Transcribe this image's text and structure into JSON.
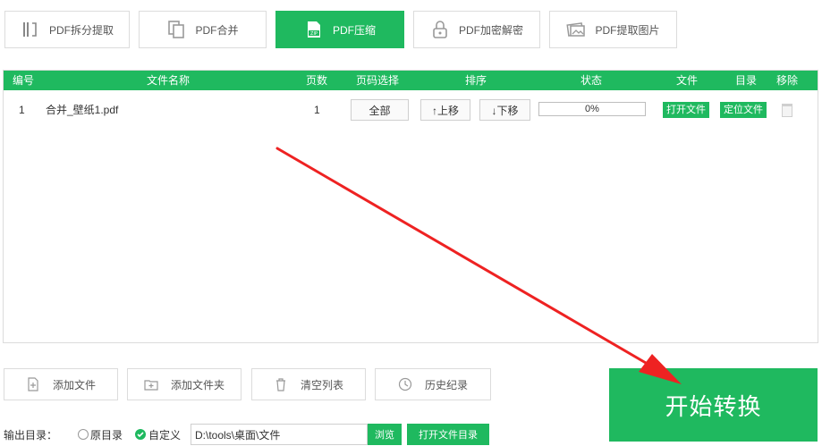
{
  "tabs": [
    {
      "label": "PDF拆分提取",
      "icon": "split-icon"
    },
    {
      "label": "PDF合并",
      "icon": "merge-icon"
    },
    {
      "label": "PDF压缩",
      "icon": "zip-icon",
      "active": true
    },
    {
      "label": "PDF加密解密",
      "icon": "lock-icon"
    },
    {
      "label": "PDF提取图片",
      "icon": "image-icon"
    }
  ],
  "table": {
    "headers": {
      "index": "编号",
      "filename": "文件名称",
      "pages": "页数",
      "page_select": "页码选择",
      "sort": "排序",
      "status": "状态",
      "file": "文件",
      "directory": "目录",
      "remove": "移除"
    },
    "rows": [
      {
        "index": "1",
        "filename": "合并_壁纸1.pdf",
        "pages": "1",
        "page_select": "全部",
        "move_up": "↑上移",
        "move_down": "↓下移",
        "progress_text": "0%",
        "progress_value": 0,
        "open_file": "打开文件",
        "locate_file": "定位文件"
      }
    ]
  },
  "actions": {
    "add_file": "添加文件",
    "add_folder": "添加文件夹",
    "clear_list": "清空列表",
    "history": "历史纪录"
  },
  "start_button": "开始转换",
  "output": {
    "label": "输出目录：",
    "option_original": "原目录",
    "option_custom": "自定义",
    "selected": "custom",
    "path": "D:\\tools\\桌面\\文件",
    "browse": "浏览",
    "open_dir": "打开文件目录"
  },
  "colors": {
    "accent": "#1fb95f",
    "arrow": "#ee2222"
  }
}
